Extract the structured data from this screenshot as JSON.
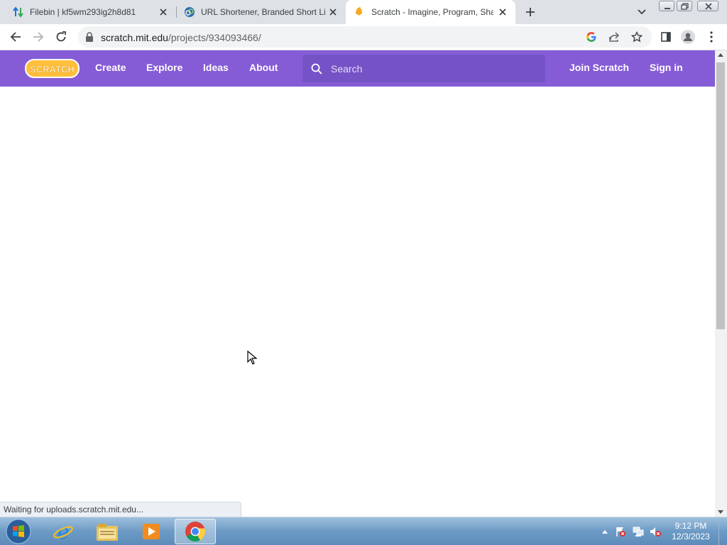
{
  "browser": {
    "tabs": [
      {
        "title": "Filebin | kf5wm293ig2h8d81",
        "icon": "filebin-icon",
        "active": false
      },
      {
        "title": "URL Shortener, Branded Short Links",
        "icon": "link-icon",
        "active": false
      },
      {
        "title": "Scratch - Imagine, Program, Share",
        "icon": "scratch-cat-icon",
        "active": true
      }
    ],
    "url_host": "scratch.mit.edu",
    "url_path": "/projects/934093466/",
    "status_text": "Waiting for uploads.scratch.mit.edu..."
  },
  "scratch": {
    "logo_text": "SCRATCH",
    "nav": {
      "create": "Create",
      "explore": "Explore",
      "ideas": "Ideas",
      "about": "About"
    },
    "search_placeholder": "Search",
    "join": "Join Scratch",
    "sign_in": "Sign in",
    "header_color": "#855cd6"
  },
  "taskbar": {
    "apps": [
      "internet-explorer-icon",
      "file-explorer-icon",
      "media-player-icon",
      "chrome-icon"
    ],
    "active_app": "chrome-icon",
    "time": "9:12 PM",
    "date": "12/3/2023"
  }
}
